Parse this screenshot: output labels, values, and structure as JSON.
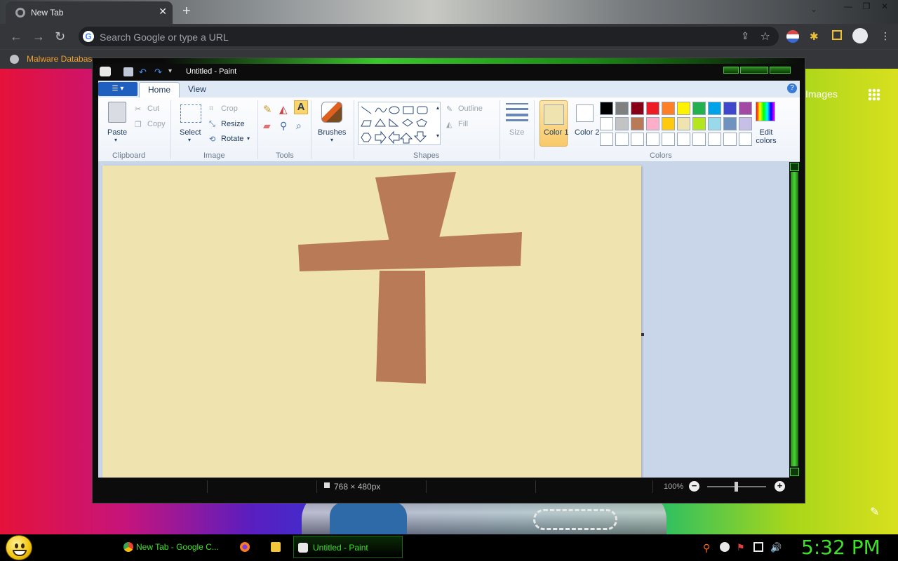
{
  "browser": {
    "tab_title": "New Tab",
    "omnibox_placeholder": "Search Google or type a URL",
    "bookmark_label": "Malware Databas",
    "google_link": "Images"
  },
  "paint": {
    "window_title": "Untitled - Paint",
    "file_menu_icon": "menu-icon",
    "tabs": [
      "Home",
      "View"
    ],
    "clipboard": {
      "paste": "Paste",
      "cut": "Cut",
      "copy": "Copy",
      "group": "Clipboard"
    },
    "image": {
      "select": "Select",
      "crop": "Crop",
      "resize": "Resize",
      "rotate": "Rotate",
      "group": "Image"
    },
    "tools": {
      "group": "Tools"
    },
    "brushes": "Brushes",
    "shapes": {
      "outline": "Outline",
      "fill": "Fill",
      "group": "Shapes"
    },
    "size": "Size",
    "color1": "Color 1",
    "color2": "Color 2",
    "edit_colors": "Edit colors",
    "colors_group": "Colors",
    "palette_row1": [
      "#000000",
      "#7f7f7f",
      "#880015",
      "#ed1c24",
      "#ff7f27",
      "#fff200",
      "#22b14c",
      "#00a2e8",
      "#3f48cc",
      "#a349a4"
    ],
    "palette_row2": [
      "#ffffff",
      "#c3c3c3",
      "#b97a57",
      "#ffaec9",
      "#ffc90e",
      "#efe4b0",
      "#b5e61d",
      "#99d9ea",
      "#7092be",
      "#c8bfe7"
    ],
    "canvas_bg": "#efe4b0",
    "brush_color": "#b97a57",
    "status_dimensions": "768 × 480px",
    "zoom": "100%"
  },
  "taskbar": {
    "tasks": [
      "New Tab - Google C...",
      "Untitled - Paint"
    ],
    "clock": "5:32 PM",
    "accent": "#3fe02a"
  }
}
